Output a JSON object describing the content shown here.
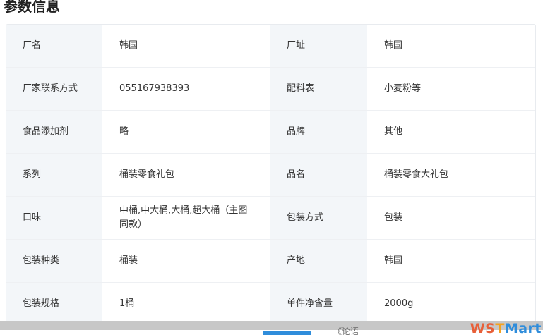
{
  "section": {
    "title": "参数信息"
  },
  "params": [
    {
      "l1": "厂名",
      "v1": "韩国",
      "l2": "厂址",
      "v2": "韩国"
    },
    {
      "l1": "厂家联系方式",
      "v1": "055167938393",
      "l2": "配料表",
      "v2": "小麦粉等"
    },
    {
      "l1": "食品添加剂",
      "v1": "略",
      "l2": "品牌",
      "v2": "其他"
    },
    {
      "l1": "系列",
      "v1": "桶装零食礼包",
      "l2": "品名",
      "v2": "桶装零食大礼包"
    },
    {
      "l1": "口味",
      "v1": "中桶,中大桶,大桶,超大桶（主图同款）",
      "l2": "包装方式",
      "v2": "包装"
    },
    {
      "l1": "包装种类",
      "v1": "桶装",
      "l2": "产地",
      "v2": "韩国"
    },
    {
      "l1": "包装规格",
      "v1": "1桶",
      "l2": "单件净含量",
      "v2": "2000g"
    }
  ],
  "footer": {
    "fragment_text": "《论语",
    "watermark": {
      "part1": "WS",
      "part2": "T",
      "part3": "Mart"
    }
  }
}
